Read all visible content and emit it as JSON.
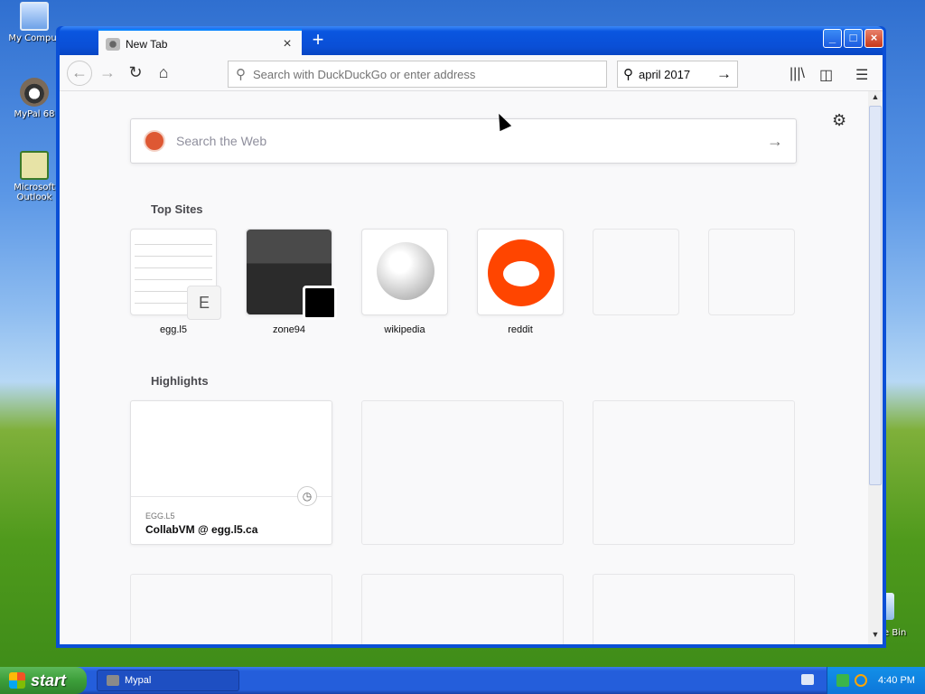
{
  "desktop": {
    "icons": [
      {
        "label": "My Comput",
        "icon": "computer-icon"
      },
      {
        "label": "MyPal 68",
        "icon": "raccoon-icon"
      },
      {
        "label": "Microsoft Outlook",
        "icon": "outlook-icon"
      }
    ],
    "recycle_label": "e Bin"
  },
  "browser": {
    "tab_title": "New Tab",
    "url_placeholder": "Search with DuckDuckGo or enter address",
    "search_box_value": "april 2017",
    "web_search_placeholder": "Search the Web",
    "top_sites_title": "Top Sites",
    "top_sites": [
      {
        "label": "egg.l5"
      },
      {
        "label": "zone94"
      },
      {
        "label": "wikipedia"
      },
      {
        "label": "reddit"
      },
      {
        "label": ""
      },
      {
        "label": ""
      }
    ],
    "egg_badge": "E",
    "highlights_title": "Highlights",
    "highlight": {
      "host": "EGG.L5",
      "title": "CollabVM @ egg.l5.ca"
    }
  },
  "taskbar": {
    "start_label": "start",
    "task_label": "Mypal",
    "clock": "4:40 PM"
  }
}
